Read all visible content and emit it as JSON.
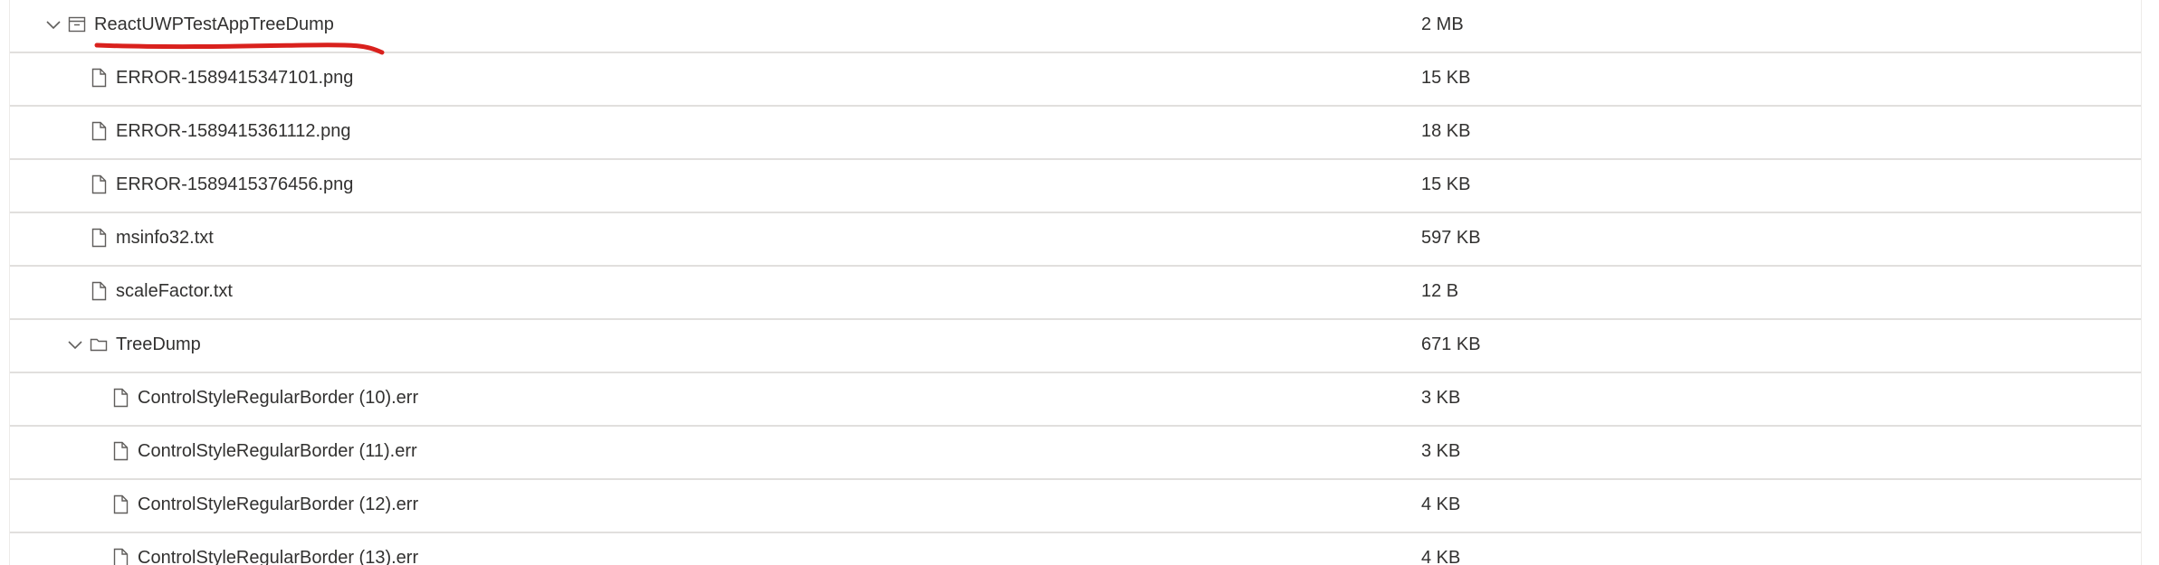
{
  "colors": {
    "text": "#323130",
    "divider": "#e1dfdd",
    "icon": "#605e5c",
    "annotation": "#d9211d"
  },
  "rows": [
    {
      "name": "ReactUWPTestAppTreeDump",
      "size": "2 MB",
      "kind": "archive",
      "expanded": true
    },
    {
      "name": "ERROR-1589415347101.png",
      "size": "15 KB",
      "kind": "file"
    },
    {
      "name": "ERROR-1589415361112.png",
      "size": "18 KB",
      "kind": "file"
    },
    {
      "name": "ERROR-1589415376456.png",
      "size": "15 KB",
      "kind": "file"
    },
    {
      "name": "msinfo32.txt",
      "size": "597 KB",
      "kind": "file"
    },
    {
      "name": "scaleFactor.txt",
      "size": "12 B",
      "kind": "file"
    },
    {
      "name": "TreeDump",
      "size": "671 KB",
      "kind": "folder",
      "expanded": true
    },
    {
      "name": "ControlStyleRegularBorder (10).err",
      "size": "3 KB",
      "kind": "file"
    },
    {
      "name": "ControlStyleRegularBorder (11).err",
      "size": "3 KB",
      "kind": "file"
    },
    {
      "name": "ControlStyleRegularBorder (12).err",
      "size": "4 KB",
      "kind": "file"
    },
    {
      "name": "ControlStyleRegularBorder (13).err",
      "size": "4 KB",
      "kind": "file"
    }
  ]
}
